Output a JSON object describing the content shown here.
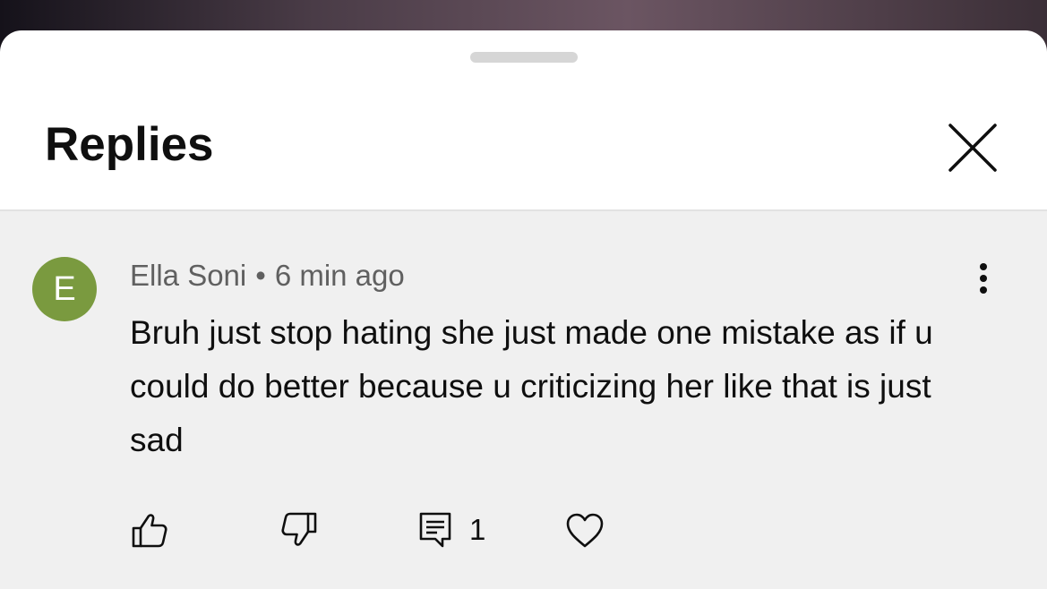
{
  "header": {
    "title": "Replies"
  },
  "comment": {
    "avatar_letter": "E",
    "author": "Ella Soni",
    "separator": "•",
    "time": "6 min ago",
    "text": "Bruh just stop hating she just made one mistake as if u could do better because u criticizing her like that is just sad",
    "reply_count": "1"
  },
  "icons": {
    "close": "close-icon",
    "more": "more-vertical-icon",
    "like": "thumbs-up-icon",
    "dislike": "thumbs-down-icon",
    "reply": "reply-comment-icon",
    "heart": "heart-icon"
  },
  "colors": {
    "avatar_bg": "#7a9a3f",
    "comment_bg": "#f0f0f0",
    "meta_text": "#606060"
  }
}
